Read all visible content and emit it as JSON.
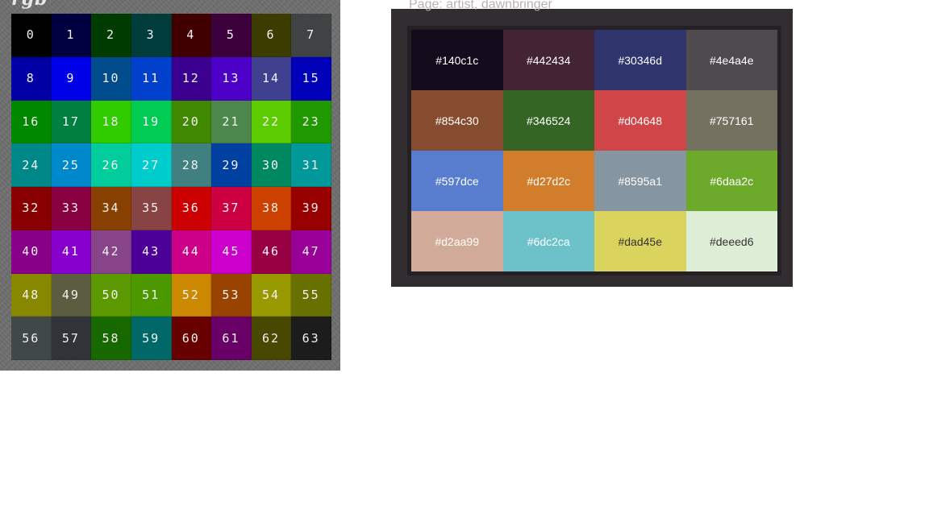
{
  "left": {
    "title": "rgb",
    "cells": [
      {
        "label": "0",
        "color": "#000000"
      },
      {
        "label": "1",
        "color": "#000040"
      },
      {
        "label": "2",
        "color": "#003c00"
      },
      {
        "label": "3",
        "color": "#003c3c"
      },
      {
        "label": "4",
        "color": "#400000"
      },
      {
        "label": "5",
        "color": "#3c003c"
      },
      {
        "label": "6",
        "color": "#3c3c00"
      },
      {
        "label": "7",
        "color": "#3f4343"
      },
      {
        "label": "8",
        "color": "#0000a4"
      },
      {
        "label": "9",
        "color": "#0000e8"
      },
      {
        "label": "10",
        "color": "#004c8c"
      },
      {
        "label": "11",
        "color": "#0040cc"
      },
      {
        "label": "12",
        "color": "#3c0090"
      },
      {
        "label": "13",
        "color": "#4c00c8"
      },
      {
        "label": "14",
        "color": "#404090"
      },
      {
        "label": "15",
        "color": "#0000b8"
      },
      {
        "label": "16",
        "color": "#008800"
      },
      {
        "label": "17",
        "color": "#008040"
      },
      {
        "label": "18",
        "color": "#30cc00"
      },
      {
        "label": "19",
        "color": "#00cc54"
      },
      {
        "label": "20",
        "color": "#408800"
      },
      {
        "label": "21",
        "color": "#4c884c"
      },
      {
        "label": "22",
        "color": "#5ccc00"
      },
      {
        "label": "23",
        "color": "#209800"
      },
      {
        "label": "24",
        "color": "#008888"
      },
      {
        "label": "25",
        "color": "#0088cc"
      },
      {
        "label": "26",
        "color": "#00cc9c"
      },
      {
        "label": "27",
        "color": "#00cccc"
      },
      {
        "label": "28",
        "color": "#408080"
      },
      {
        "label": "29",
        "color": "#0040a0"
      },
      {
        "label": "30",
        "color": "#008860"
      },
      {
        "label": "31",
        "color": "#009898"
      },
      {
        "label": "32",
        "color": "#880000"
      },
      {
        "label": "33",
        "color": "#880040"
      },
      {
        "label": "34",
        "color": "#884000"
      },
      {
        "label": "35",
        "color": "#884444"
      },
      {
        "label": "36",
        "color": "#cc0000"
      },
      {
        "label": "37",
        "color": "#cc0040"
      },
      {
        "label": "38",
        "color": "#cc4000"
      },
      {
        "label": "39",
        "color": "#980000"
      },
      {
        "label": "40",
        "color": "#880088"
      },
      {
        "label": "41",
        "color": "#8800cc"
      },
      {
        "label": "42",
        "color": "#884488"
      },
      {
        "label": "43",
        "color": "#4c0098"
      },
      {
        "label": "44",
        "color": "#cc0088"
      },
      {
        "label": "45",
        "color": "#cc00cc"
      },
      {
        "label": "46",
        "color": "#980044"
      },
      {
        "label": "47",
        "color": "#980098"
      },
      {
        "label": "48",
        "color": "#888800"
      },
      {
        "label": "49",
        "color": "#5c5c40"
      },
      {
        "label": "50",
        "color": "#5c9800"
      },
      {
        "label": "51",
        "color": "#4c9800"
      },
      {
        "label": "52",
        "color": "#cc8800"
      },
      {
        "label": "53",
        "color": "#984400"
      },
      {
        "label": "54",
        "color": "#989800"
      },
      {
        "label": "55",
        "color": "#687000"
      },
      {
        "label": "56",
        "color": "#404848"
      },
      {
        "label": "57",
        "color": "#303438"
      },
      {
        "label": "58",
        "color": "#186800"
      },
      {
        "label": "59",
        "color": "#006868"
      },
      {
        "label": "60",
        "color": "#680000"
      },
      {
        "label": "61",
        "color": "#680068"
      },
      {
        "label": "62",
        "color": "#484800"
      },
      {
        "label": "63",
        "color": "#1c1c1c"
      }
    ]
  },
  "right": {
    "title": "Page: artist, dawnbringer",
    "cells": [
      {
        "label": "#140c1c",
        "color": "#140c1c",
        "text": "#ffffff"
      },
      {
        "label": "#442434",
        "color": "#442434",
        "text": "#ffffff"
      },
      {
        "label": "#30346d",
        "color": "#30346d",
        "text": "#ffffff"
      },
      {
        "label": "#4e4a4e",
        "color": "#4e4a4e",
        "text": "#ffffff"
      },
      {
        "label": "#854c30",
        "color": "#854c30",
        "text": "#ffffff"
      },
      {
        "label": "#346524",
        "color": "#346524",
        "text": "#ffffff"
      },
      {
        "label": "#d04648",
        "color": "#d04648",
        "text": "#ffffff"
      },
      {
        "label": "#757161",
        "color": "#757161",
        "text": "#ffffff"
      },
      {
        "label": "#597dce",
        "color": "#597dce",
        "text": "#ffffff"
      },
      {
        "label": "#d27d2c",
        "color": "#d27d2c",
        "text": "#ffffff"
      },
      {
        "label": "#8595a1",
        "color": "#8595a1",
        "text": "#ffffff"
      },
      {
        "label": "#6daa2c",
        "color": "#6daa2c",
        "text": "#ffffff"
      },
      {
        "label": "#d2aa99",
        "color": "#d2aa99",
        "text": "#ffffff"
      },
      {
        "label": "#6dc2ca",
        "color": "#6dc2ca",
        "text": "#ffffff"
      },
      {
        "label": "#dad45e",
        "color": "#dad45e",
        "text": "#333333"
      },
      {
        "label": "#deeed6",
        "color": "#deeed6",
        "text": "#333333"
      }
    ]
  }
}
